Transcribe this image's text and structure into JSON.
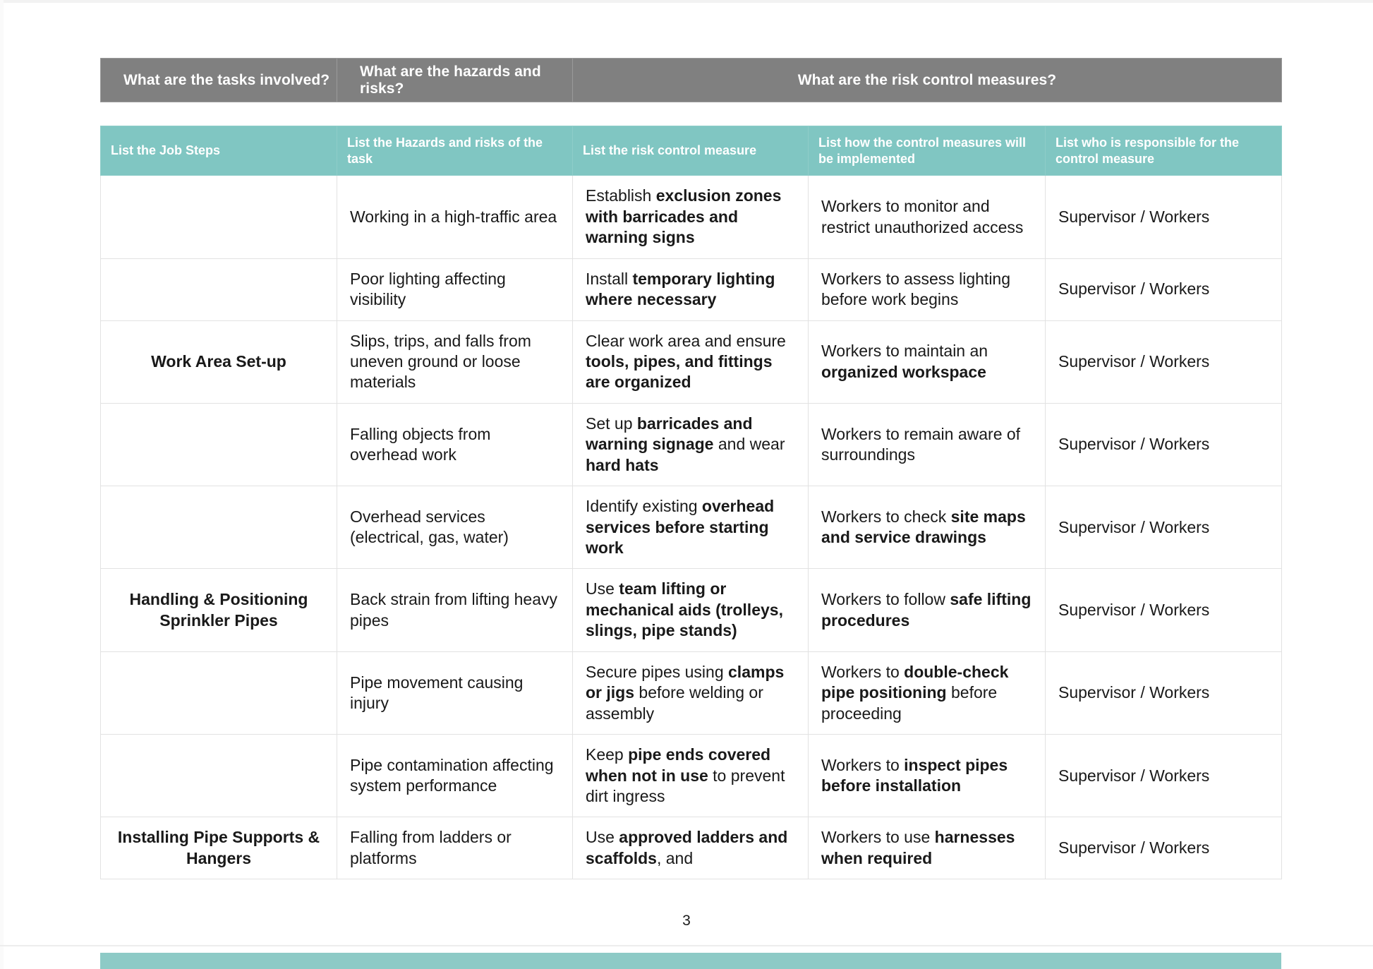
{
  "document": {
    "page_number": "3",
    "colors": {
      "banner_background": "#808080",
      "subheader_background": "#80c6c2",
      "banner_text": "#ffffff",
      "body_text": "#191919",
      "cell_border": "#e2e2e2",
      "bottom_band": "#8dcac6"
    }
  },
  "table": {
    "banner": {
      "tasks": "What are the tasks involved?",
      "hazards": "What are the hazards and risks?",
      "controls": "What are the risk control measures?"
    },
    "subheaders": [
      "List the Job Steps",
      "List the Hazards and risks of the task",
      "List the risk control measure",
      "List how the control measures will be implemented",
      "List who is responsible for the control measure"
    ],
    "rows": [
      {
        "job_step": "",
        "hazard": "Working in a high-traffic area",
        "control_measure_html": "Establish <b>exclusion zones with barricades and warning signs</b>",
        "control_measure_text": "Establish exclusion zones with barricades and warning signs",
        "implementation_html": "Workers to monitor and restrict unauthorized access",
        "implementation_text": "Workers to monitor and restrict unauthorized access",
        "responsible": "Supervisor / Workers"
      },
      {
        "job_step": "",
        "hazard": "Poor lighting affecting visibility",
        "control_measure_html": "Install <b>temporary lighting where necessary</b>",
        "control_measure_text": "Install temporary lighting where necessary",
        "implementation_html": "Workers to assess lighting before work begins",
        "implementation_text": "Workers to assess lighting before work begins",
        "responsible": "Supervisor / Workers"
      },
      {
        "job_step": "Work Area Set-up",
        "hazard": "Slips, trips, and falls from uneven ground or loose materials",
        "control_measure_html": "Clear work area and ensure <b>tools, pipes, and fittings are organized</b>",
        "control_measure_text": "Clear work area and ensure tools, pipes, and fittings are organized",
        "implementation_html": "Workers to maintain an <b>organized workspace</b>",
        "implementation_text": "Workers to maintain an organized workspace",
        "responsible": "Supervisor / Workers"
      },
      {
        "job_step": "",
        "hazard": "Falling objects from overhead work",
        "control_measure_html": "Set up <b>barricades and warning signage</b> and wear <b>hard hats</b>",
        "control_measure_text": "Set up barricades and warning signage and wear hard hats",
        "implementation_html": "Workers to remain aware of surroundings",
        "implementation_text": "Workers to remain aware of surroundings",
        "responsible": "Supervisor / Workers"
      },
      {
        "job_step": "",
        "hazard": "Overhead services (electrical, gas, water)",
        "control_measure_html": "Identify existing <b>overhead services before starting work</b>",
        "control_measure_text": "Identify existing overhead services before starting work",
        "implementation_html": "Workers to check <b>site maps and service drawings</b>",
        "implementation_text": "Workers to check site maps and service drawings",
        "responsible": "Supervisor / Workers"
      },
      {
        "job_step": "Handling & Positioning Sprinkler Pipes",
        "hazard": "Back strain from lifting heavy pipes",
        "control_measure_html": "Use <b>team lifting or mechanical aids (trolleys, slings, pipe stands)</b>",
        "control_measure_text": "Use team lifting or mechanical aids (trolleys, slings, pipe stands)",
        "implementation_html": "Workers to follow <b>safe lifting procedures</b>",
        "implementation_text": "Workers to follow safe lifting procedures",
        "responsible": "Supervisor / Workers"
      },
      {
        "job_step": "",
        "hazard": "Pipe movement causing injury",
        "control_measure_html": "Secure pipes using <b>clamps or jigs</b> before welding or assembly",
        "control_measure_text": "Secure pipes using clamps or jigs before welding or assembly",
        "implementation_html": "Workers to <b>double-check pipe positioning</b> before proceeding",
        "implementation_text": "Workers to double-check pipe positioning before proceeding",
        "responsible": "Supervisor / Workers"
      },
      {
        "job_step": "",
        "hazard": "Pipe contamination affecting system performance",
        "control_measure_html": "Keep <b>pipe ends covered when not in use</b> to prevent dirt ingress",
        "control_measure_text": "Keep pipe ends covered when not in use to prevent dirt ingress",
        "implementation_html": "Workers to <b>inspect pipes before installation</b>",
        "implementation_text": "Workers to inspect pipes before installation",
        "responsible": "Supervisor / Workers"
      },
      {
        "job_step": "Installing Pipe Supports & Hangers",
        "hazard": "Falling from ladders or platforms",
        "control_measure_html": "Use <b>approved ladders and scaffolds</b>, and",
        "control_measure_text": "Use approved ladders and scaffolds, and",
        "implementation_html": "Workers to use <b>harnesses when required</b>",
        "implementation_text": "Workers to use harnesses when required",
        "responsible": "Supervisor / Workers"
      }
    ]
  }
}
